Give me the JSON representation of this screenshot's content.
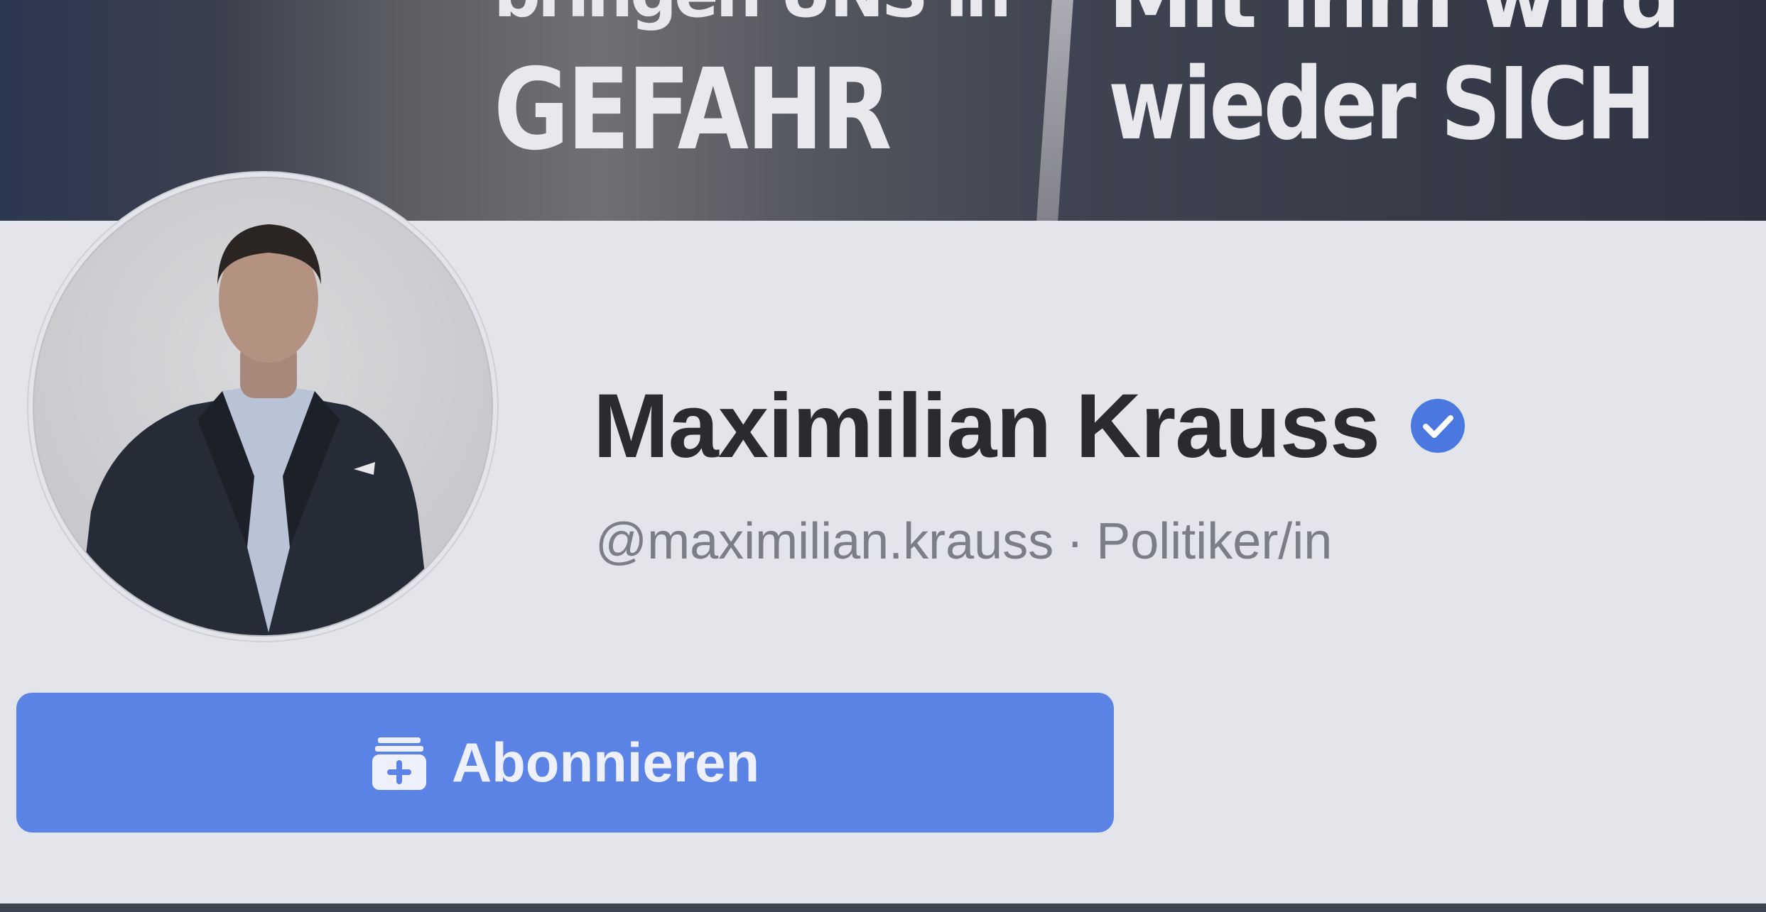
{
  "cover": {
    "left_line1": "bringen UNS in",
    "left_line2": "GEFAHR",
    "right_line1": "Mit ihm wird",
    "right_line2": "wieder SICH"
  },
  "profile": {
    "name": "Maximilian Krauss",
    "verified_icon": "verified-badge-icon",
    "handle": "@maximilian.krauss",
    "separator": "·",
    "category": "Politiker/in"
  },
  "actions": {
    "subscribe_label": "Abonnieren",
    "subscribe_icon": "subscribe-plus-icon"
  },
  "colors": {
    "background": "#e4e5ea",
    "primary_button": "#5b83e5",
    "verified_badge": "#4a78e0",
    "name_text": "#2a2b30",
    "sub_text": "#7c7e85"
  }
}
